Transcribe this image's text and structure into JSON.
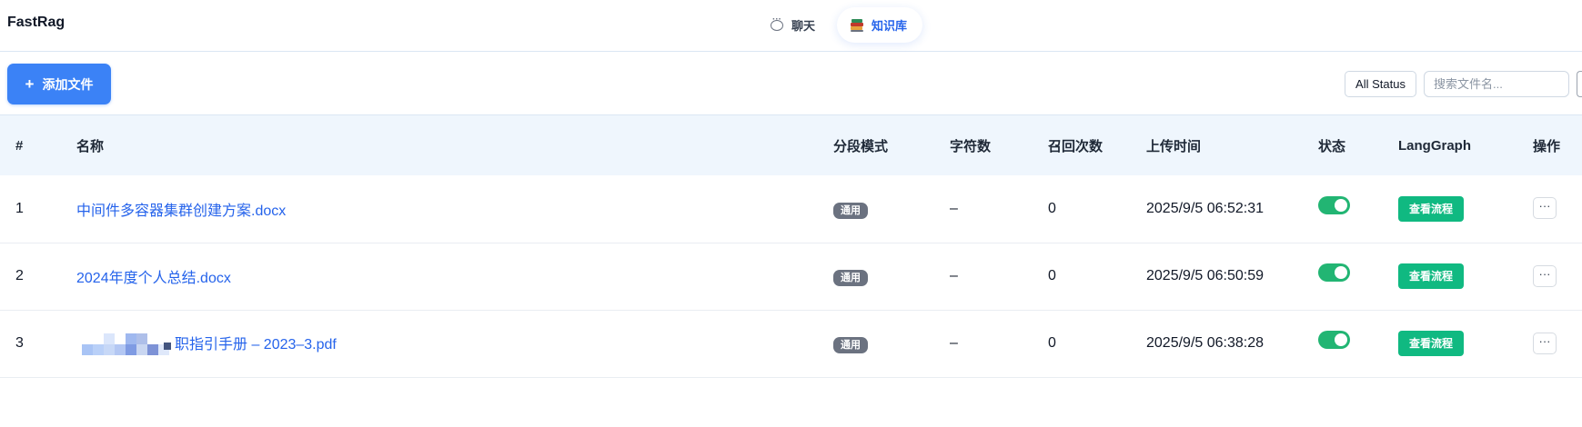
{
  "app": {
    "title": "FastRag"
  },
  "nav": {
    "chat_label": "聊天",
    "kb_label": "知识库",
    "chat_icon": "chat-bubble-icon",
    "kb_icon": "books-icon",
    "active": "kb"
  },
  "toolbar": {
    "add_plus": "+",
    "add_label": "添加文件",
    "status_filter": "All Status",
    "search_placeholder": "搜索文件名...",
    "search_value": ""
  },
  "table": {
    "headers": {
      "index": "#",
      "name": "名称",
      "mode": "分段模式",
      "chars": "字符数",
      "recalls": "召回次数",
      "uploaded": "上传时间",
      "status": "状态",
      "langgraph": "LangGraph",
      "actions": "操作"
    },
    "rows": [
      {
        "index": "1",
        "name": "中间件多容器集群创建方案.docx",
        "mode": "通用",
        "chars": "–",
        "recalls": "0",
        "uploaded": "2025/9/5 06:52:31",
        "enabled": true,
        "flow_label": "查看流程",
        "more": "···"
      },
      {
        "index": "2",
        "name": "2024年度个人总结.docx",
        "mode": "通用",
        "chars": "–",
        "recalls": "0",
        "uploaded": "2025/9/5 06:50:59",
        "enabled": true,
        "flow_label": "查看流程",
        "more": "···"
      },
      {
        "index": "3",
        "name": "职指引手册 – 2023–3.pdf",
        "mode": "通用",
        "chars": "–",
        "recalls": "0",
        "uploaded": "2025/9/5 06:38:28",
        "enabled": true,
        "flow_label": "查看流程",
        "more": "···"
      }
    ]
  },
  "colors": {
    "primary": "#3b82f6",
    "link": "#2563eb",
    "success": "#10b981",
    "toggle_on": "#22b573",
    "header_bg": "#eff6fd",
    "badge": "#6b7280"
  }
}
